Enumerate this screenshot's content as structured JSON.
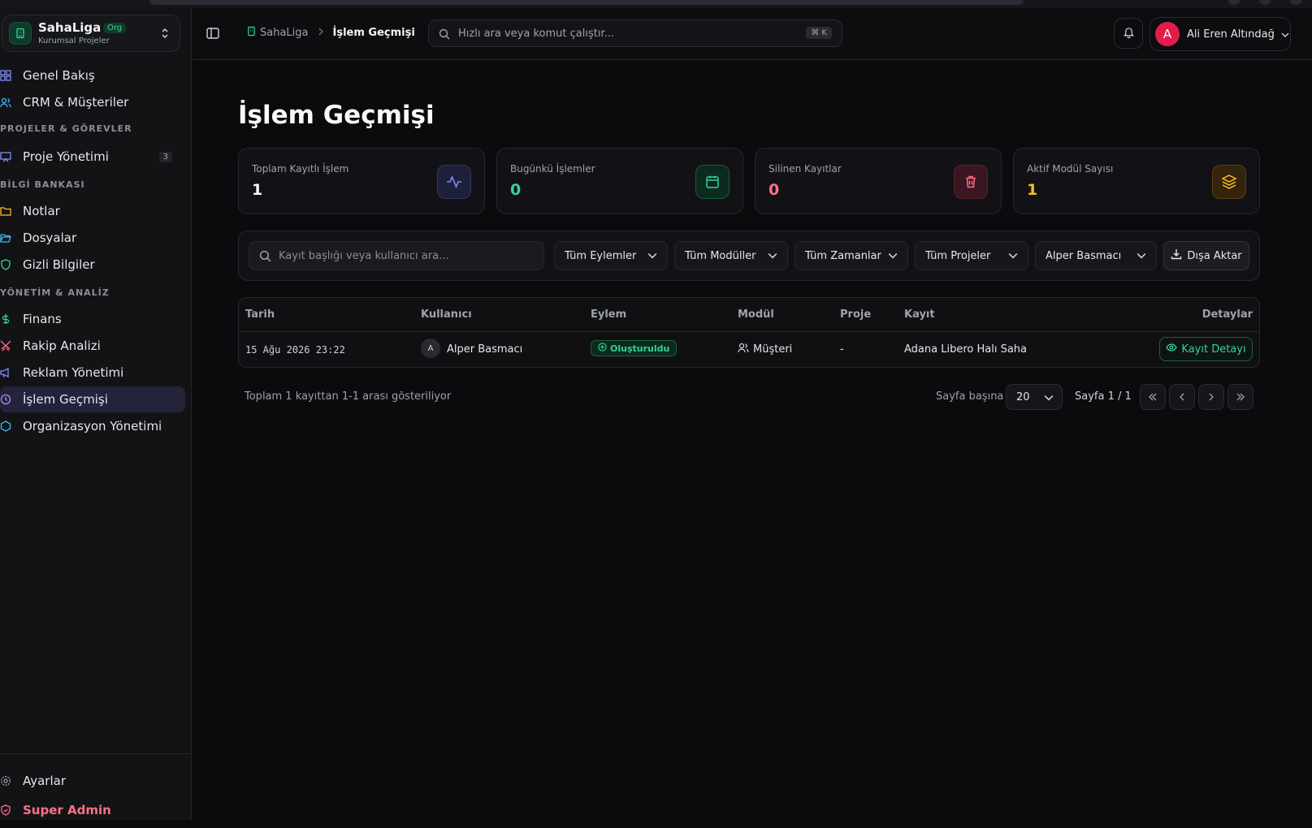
{
  "sidebar": {
    "org": {
      "name": "SahaLiga",
      "badge": "Org",
      "subtitle": "Kurumsal Projeler"
    },
    "nav": {
      "overview": "Genel Bakış",
      "crm": "CRM & Müşteriler",
      "section_projects": "PROJELER & GÖREVLER",
      "projects": "Proje Yönetimi",
      "projects_count": "3",
      "section_knowledge": "BİLGİ BANKASI",
      "notes": "Notlar",
      "files": "Dosyalar",
      "secrets": "Gizli Bilgiler",
      "section_management": "YÖNETİM & ANALİZ",
      "finance": "Finans",
      "competitors": "Rakip Analizi",
      "ads": "Reklam Yönetimi",
      "history": "İşlem Geçmişi",
      "organization": "Organizasyon Yönetimi"
    },
    "bottom": {
      "settings": "Ayarlar",
      "super_admin": "Super Admin"
    }
  },
  "header": {
    "breadcrumb_home": "SahaLiga",
    "breadcrumb_current": "İşlem Geçmişi",
    "search_placeholder": "Hızlı ara veya komut çalıştır...",
    "search_shortcut": "⌘ K",
    "user_initial": "A",
    "user_name": "Ali Eren Altındağ"
  },
  "page": {
    "title": "İşlem Geçmişi",
    "stats": [
      {
        "label": "Toplam Kayıtlı İşlem",
        "value": "1",
        "color": "#f9fafb"
      },
      {
        "label": "Bugünkü İşlemler",
        "value": "0",
        "color": "#34d399"
      },
      {
        "label": "Silinen Kayıtlar",
        "value": "0",
        "color": "#fb7185"
      },
      {
        "label": "Aktif Modül Sayısı",
        "value": "1",
        "color": "#fbbf24"
      }
    ],
    "filters": {
      "search_placeholder": "Kayıt başlığı veya kullanıcı ara...",
      "actions": "Tüm Eylemler",
      "modules": "Tüm Modüller",
      "times": "Tüm Zamanlar",
      "projects": "Tüm Projeler",
      "user": "Alper Basmacı",
      "export": "Dışa Aktar"
    },
    "table": {
      "headers": [
        "Tarih",
        "Kullanıcı",
        "Eylem",
        "Modül",
        "Proje",
        "Kayıt",
        "Detaylar"
      ],
      "rows": [
        {
          "date": "15 Ağu 2026 23:22",
          "user_initial": "A",
          "user": "Alper Basmacı",
          "action": "Oluşturuldu",
          "module": "Müşteri",
          "project": "-",
          "record": "Adana Libero Halı Saha",
          "detail": "Kayıt Detayı"
        }
      ]
    },
    "pagination": {
      "summary": "Toplam 1 kayıttan 1-1 arası gösteriliyor",
      "per_page_label": "Sayfa başına",
      "per_page_value": "20",
      "page_label": "Sayfa 1 / 1"
    }
  },
  "colors": {
    "accent": "#34d399",
    "danger": "#fb7185",
    "warning": "#fbbf24",
    "indigo": "#818cf8"
  }
}
